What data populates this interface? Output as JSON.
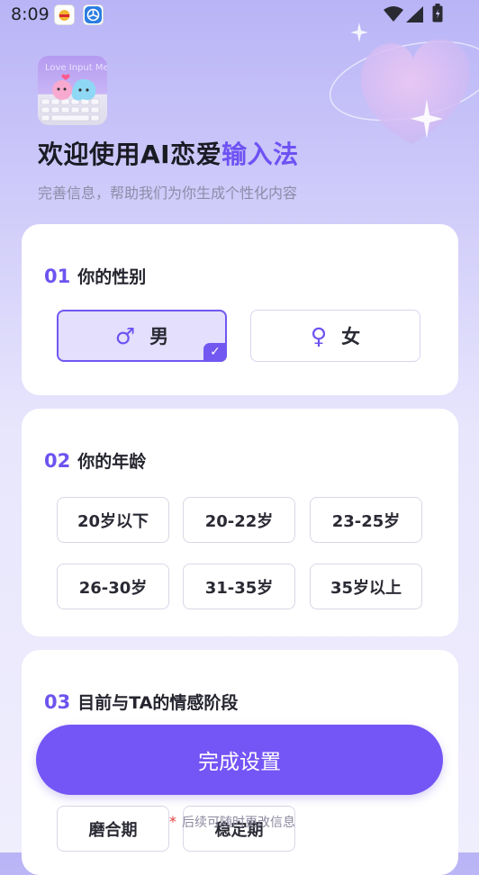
{
  "status_bar": {
    "time": "8:09"
  },
  "header": {
    "title_main": "欢迎使用AI恋爱",
    "title_accent": "输入法",
    "subtitle": "完善信息，帮助我们为你生成个性化内容",
    "logo_text": "Love Input Me"
  },
  "gender_section": {
    "number": "01",
    "title": "你的性别",
    "options": [
      {
        "symbol": "♂",
        "label": "男",
        "selected": true
      },
      {
        "symbol": "♀",
        "label": "女",
        "selected": false
      }
    ]
  },
  "age_section": {
    "number": "02",
    "title": "你的年龄",
    "options": [
      "20岁以下",
      "20-22岁",
      "23-25岁",
      "26-30岁",
      "31-35岁",
      "35岁以上"
    ]
  },
  "relationship_section": {
    "number": "03",
    "title": "目前与TA的情感阶段",
    "options": [
      "磨合期",
      "稳定期"
    ]
  },
  "complete_button": {
    "label": "完成设置"
  },
  "footer_hint": {
    "star": "*",
    "text": "后续可随时更改信息"
  },
  "colors": {
    "accent": "#7455f5",
    "selected_bg": "#e3dffc"
  }
}
